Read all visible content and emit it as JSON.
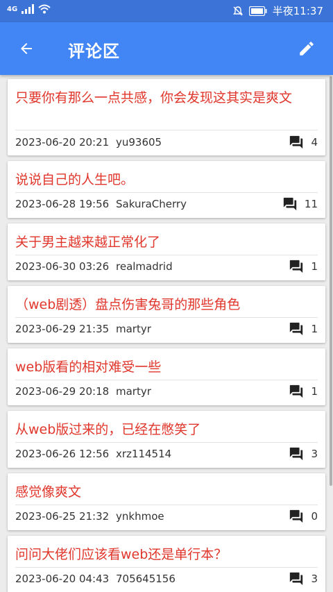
{
  "status": {
    "network": "4G",
    "time": "半夜11:37"
  },
  "header": {
    "title": "评论区"
  },
  "comments": [
    {
      "title": "只要你有那么一点共感，你会发现这其实是爽文",
      "date": "2023-06-20 20:21",
      "user": "yu93605",
      "count": "4"
    },
    {
      "title": "说说自己的人生吧。",
      "date": "2023-06-28 19:56",
      "user": "SakuraCherry",
      "count": "11"
    },
    {
      "title": "关于男主越来越正常化了",
      "date": "2023-06-30 03:26",
      "user": "realmadrid",
      "count": "1"
    },
    {
      "title": "（web剧透）盘点伤害兔哥的那些角色",
      "date": "2023-06-29 21:35",
      "user": "martyr",
      "count": "1"
    },
    {
      "title": "web版看的相对难受一些",
      "date": "2023-06-29 20:18",
      "user": "martyr",
      "count": "1"
    },
    {
      "title": "从web版过来的，已经在憋笑了",
      "date": "2023-06-26 12:56",
      "user": "xrz114514",
      "count": "3"
    },
    {
      "title": "感觉像爽文",
      "date": "2023-06-25 21:32",
      "user": "ynkhmoe",
      "count": "0"
    },
    {
      "title": "问问大佬们应该看web还是单行本？",
      "date": "2023-06-20 04:43",
      "user": "705645156",
      "count": "3"
    }
  ],
  "colors": {
    "app_bar": "#4285f4",
    "status_bar": "#3b73d6",
    "title_text": "#e0362b"
  }
}
